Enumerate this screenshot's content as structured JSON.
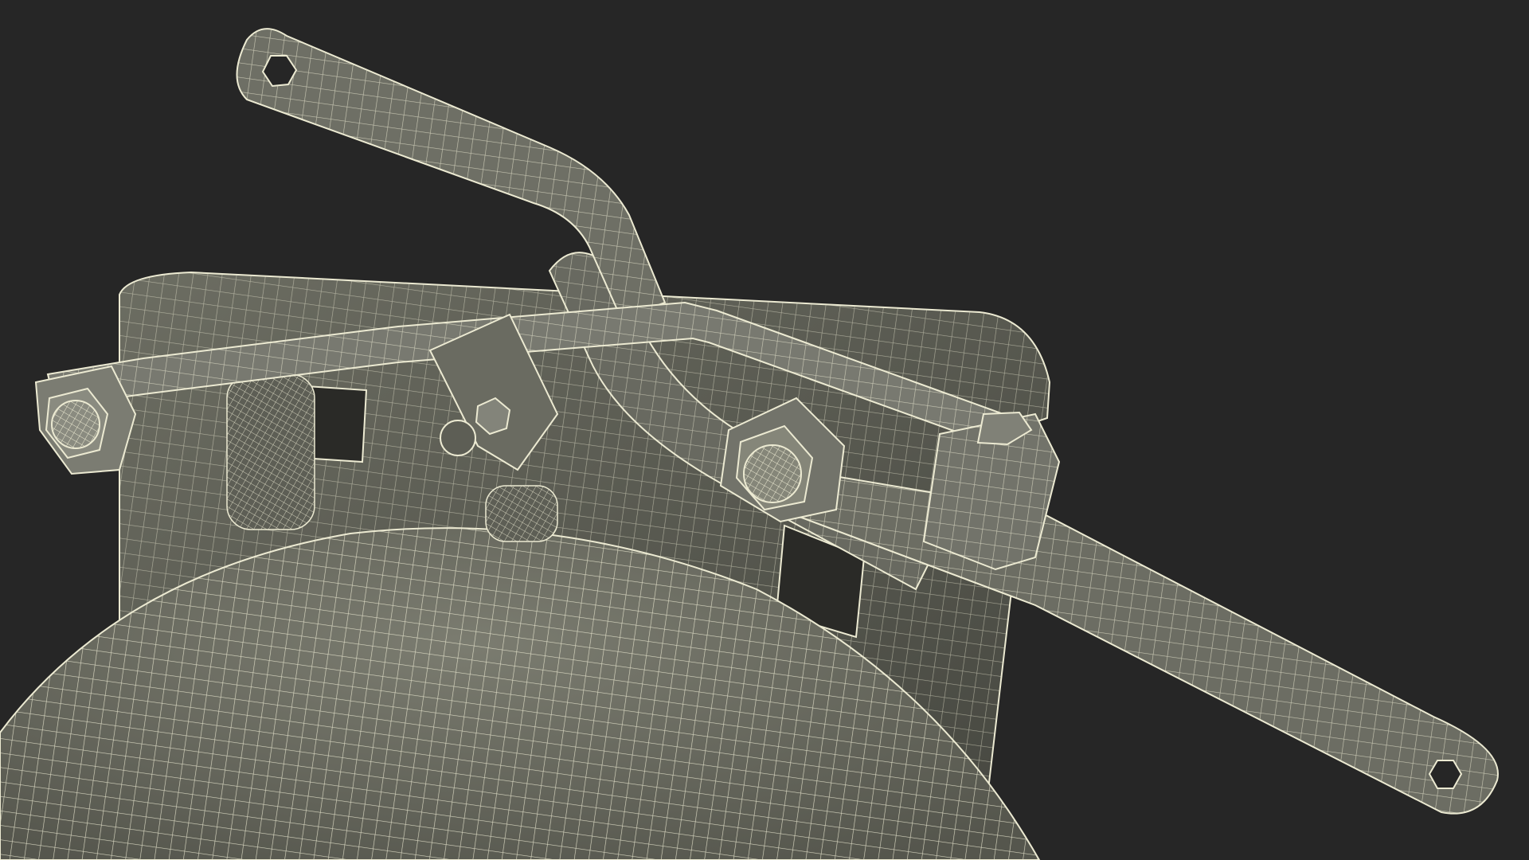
{
  "scene": {
    "background_color": "#262626",
    "surface_color": "#6f7065",
    "surface_dark_color": "#4b4c44",
    "wire_color": "#ecead2",
    "parts": [
      "mounting-plate",
      "upper-lever-arm",
      "lower-lever-arm",
      "bent-bar",
      "hex-bolt-left",
      "hex-bolt-center",
      "coil-spring-left",
      "coil-spring-center",
      "pivot-block",
      "bell-dome"
    ]
  }
}
